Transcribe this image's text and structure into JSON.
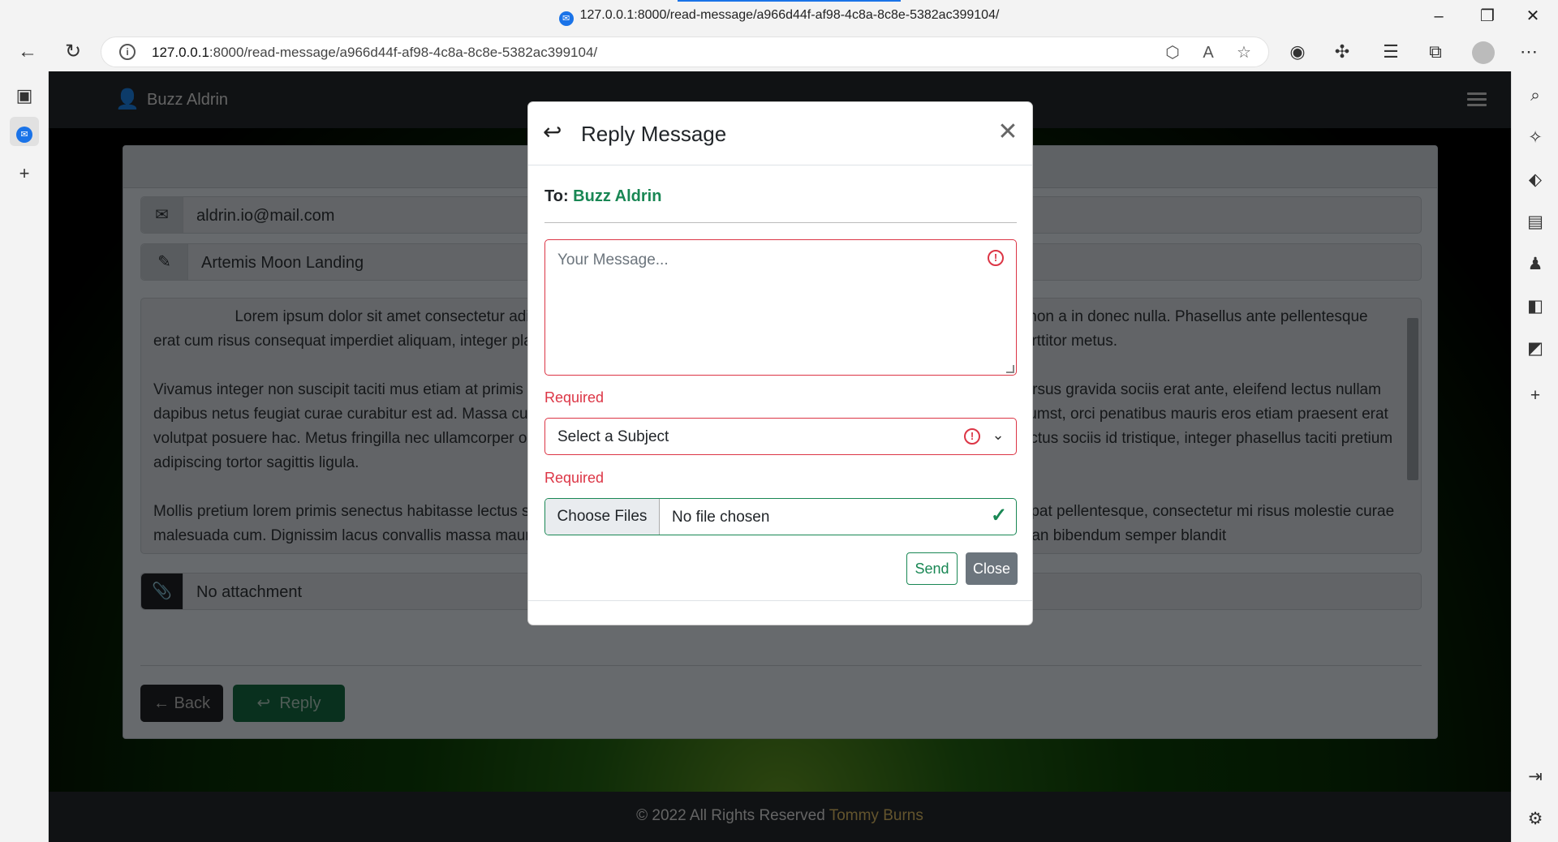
{
  "browser": {
    "tab_title": "127.0.0.1:8000/read-message/a966d44f-af98-4c8a-8c8e-5382ac399104/",
    "url_host": "127.0.0.1",
    "url_rest": ":8000/read-message/a966d44f-af98-4c8a-8c8e-5382ac399104/"
  },
  "navbar": {
    "user_name": "Buzz Aldrin"
  },
  "message": {
    "email": "aldrin.io@mail.com",
    "subject": "Artemis Moon Landing",
    "paragraph1": "                   Lorem ipsum dolor sit amet consectetur adipiscing elit, curabitur habitant nibh sodales scelerisque dictumst, aenean non a in donec nulla. Phasellus ante pellentesque erat cum risus consequat imperdiet aliquam, integer placerat et turpis mi eros nec lobortis taciti, vehicula nisl litora tellus ligula porttitor metus.",
    "paragraph2": "Vivamus integer non suscipit taciti mus etiam at primis tempor sagittis sit, euismod libero facilisi aptent elementum felis blandit cursus gravida sociis erat ante, eleifend lectus nullam dapibus netus feugiat curae curabitur est ad. Massa curae fringilla porttitor quam sollicitudin iaculis aptent leo ligula euismod dictumst, orci penatibus mauris eros etiam praesent erat volutpat posuere hac. Metus fringilla nec ullamcorper odio aliquam lacinia conubia mauris tempor, etiam ultricies proin quisque lectus sociis id tristique, integer phasellus taciti pretium adipiscing tortor sagittis ligula.",
    "paragraph3": "Mollis pretium lorem primis senectus habitasse lectus scelerisque donec, ultricies tortor suspendisse adipiscing fusce morbi volutpat pellentesque, consectetur mi risus molestie curae malesuada cum. Dignissim lacus convallis massa mauris enim ad mattis magnis senectus montes, mollis taciti phasellus accumsan bibendum semper blandit",
    "attachment": "No attachment",
    "back_label": "Back",
    "reply_label": "Reply"
  },
  "footer": {
    "text": "© 2022 All Rights Reserved",
    "owner": "Tommy Burns"
  },
  "modal": {
    "title": "Reply Message",
    "to_label": "To:",
    "to_name": "Buzz Aldrin",
    "message_placeholder": "Your Message...",
    "message_error": "Required",
    "subject_value": "Select a Subject",
    "subject_error": "Required",
    "choose_files_label": "Choose Files",
    "file_status": "No file chosen",
    "send_label": "Send",
    "close_label": "Close"
  },
  "colors": {
    "success": "#198754",
    "danger": "#dc3545",
    "navbar": "#212529"
  },
  "icons": {
    "modal_header": "reply-icon",
    "email": "envelope-icon",
    "subject": "user-pen-icon",
    "attachment": "paperclip-icon"
  }
}
